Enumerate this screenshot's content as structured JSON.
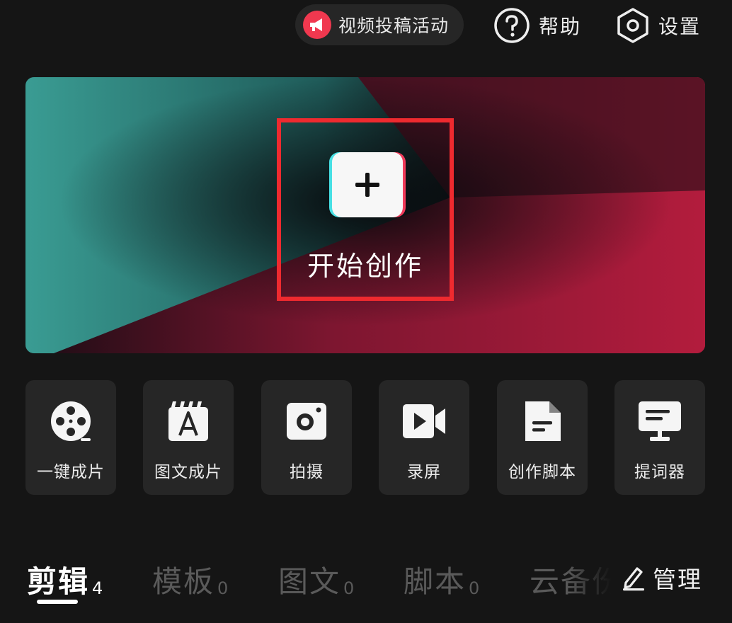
{
  "topbar": {
    "promo_label": "视频投稿活动",
    "promo_icon": "megaphone-icon",
    "help_label": "帮助",
    "help_icon": "question-circle-icon",
    "settings_label": "设置",
    "settings_icon": "hexagon-gear-icon"
  },
  "hero": {
    "start_label": "开始创作",
    "start_icon": "plus-icon",
    "highlight_color": "#ee2a2f"
  },
  "tools": [
    {
      "label": "一键成片",
      "icon": "film-reel-icon"
    },
    {
      "label": "图文成片",
      "icon": "text-clapper-icon"
    },
    {
      "label": "拍摄",
      "icon": "camera-icon"
    },
    {
      "label": "录屏",
      "icon": "video-camera-icon"
    },
    {
      "label": "创作脚本",
      "icon": "script-document-icon"
    },
    {
      "label": "提词器",
      "icon": "teleprompter-icon"
    }
  ],
  "tabs": [
    {
      "name": "剪辑",
      "count": "4",
      "active": true
    },
    {
      "name": "模板",
      "count": "0",
      "active": false
    },
    {
      "name": "图文",
      "count": "0",
      "active": false
    },
    {
      "name": "脚本",
      "count": "0",
      "active": false
    },
    {
      "name": "云备份",
      "count": "",
      "active": false
    }
  ],
  "manage": {
    "label": "管理",
    "icon": "pencil-icon"
  },
  "colors": {
    "background": "#151515",
    "card": "#262626",
    "accent_red": "#f0384f",
    "cyan": "#47e0e4"
  }
}
